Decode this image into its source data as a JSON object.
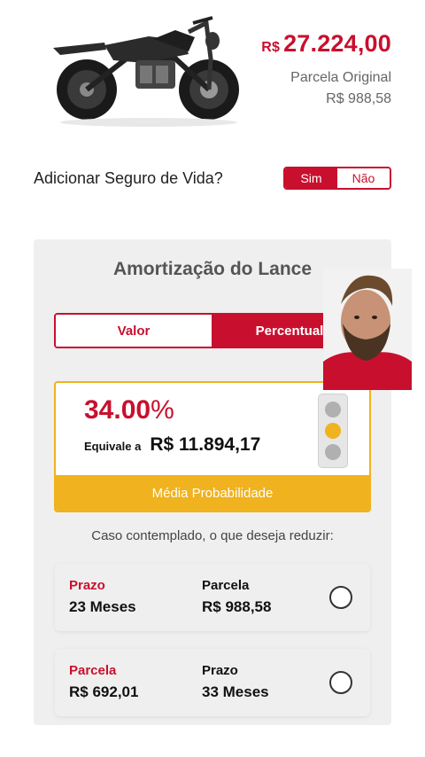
{
  "header": {
    "price_currency": "R$",
    "price_value": "27.224,00",
    "parcela_label": "Parcela Original",
    "parcela_value": "R$ 988,58"
  },
  "seguro": {
    "label": "Adicionar Seguro de Vida?",
    "yes": "Sim",
    "no": "Não",
    "selected": "Sim"
  },
  "card": {
    "title": "Amortização do Lance",
    "tabs": [
      {
        "label": "Valor",
        "active": false
      },
      {
        "label": "Percentual",
        "active": true
      }
    ],
    "percent_number": "34.00",
    "percent_symbol": "%",
    "equiv_label": "Equivale a",
    "equiv_value": "R$ 11.894,17",
    "probability": "Média Probabilidade",
    "question": "Caso contemplado, o que deseja reduzir:",
    "options": [
      {
        "label1": "Prazo",
        "value1": "23 Meses",
        "label2": "Parcela",
        "value2": "R$ 988,58"
      },
      {
        "label1": "Parcela",
        "value1": "R$ 692,01",
        "label2": "Prazo",
        "value2": "33 Meses"
      }
    ]
  },
  "colors": {
    "accent": "#c8102e",
    "warning": "#f0b21e",
    "card_bg": "#efefef"
  },
  "icons": {
    "traffic_light": "traffic-light-icon",
    "radio": "radio-icon"
  }
}
